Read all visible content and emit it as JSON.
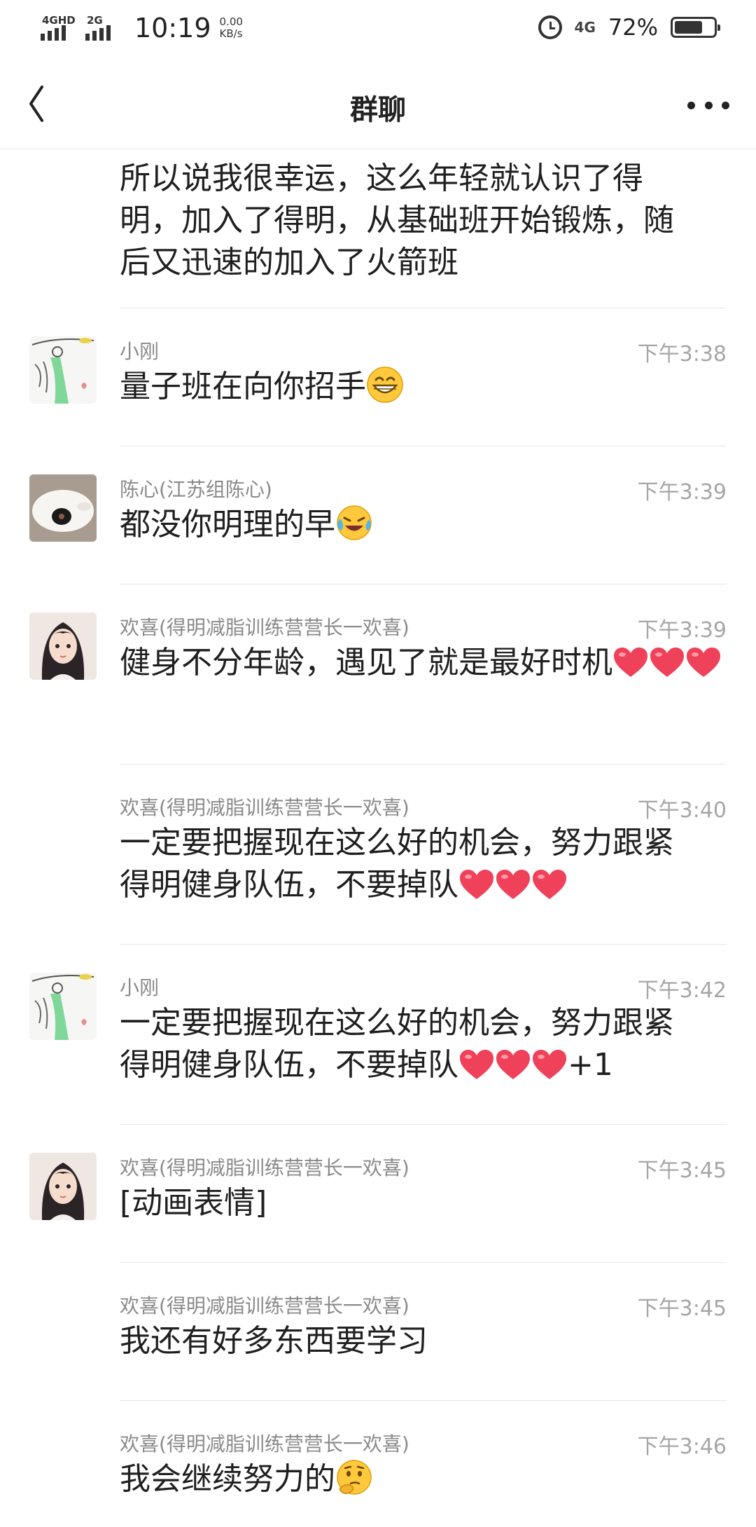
{
  "status_bar": {
    "net1": "4GHD",
    "net2": "2G",
    "time": "10:19",
    "speed_value": "0.00",
    "speed_unit": "KB/s",
    "net3": "4G",
    "battery_pct": "72%",
    "battery_level": 0.72
  },
  "header": {
    "title": "群聊"
  },
  "messages": [
    {
      "text_lines": [
        "所以说我很幸运，这么年轻就认识了得",
        "明，加入了得明，从基础班开始锻炼，随",
        "后又迅速的加入了火箭班"
      ]
    },
    {
      "name": "小刚",
      "time": "下午3:38",
      "text_lines": [
        "量子班在向你招手"
      ],
      "emoji": "grin-emoji"
    },
    {
      "name": "陈心(江苏组陈心)",
      "time": "下午3:39",
      "text_lines": [
        "都没你明理的早"
      ],
      "emoji": "laugh-cry-emoji"
    },
    {
      "name": "欢喜(得明减脂训练营营长一欢喜)",
      "time": "下午3:39",
      "text_lines": [
        "健身不分年龄，遇见了就是最好时机"
      ]
    },
    {
      "name": "欢喜(得明减脂训练营营长一欢喜)",
      "time": "下午3:40",
      "text_lines": [
        "一定要把握现在这么好的机会，努力跟紧",
        "得明健身队伍，不要掉队"
      ]
    },
    {
      "name": "小刚",
      "time": "下午3:42",
      "text_lines": [
        "一定要把握现在这么好的机会，努力跟紧",
        "得明健身队伍，不要掉队"
      ],
      "suffix": "+1"
    },
    {
      "name": "欢喜(得明减脂训练营营长一欢喜)",
      "time": "下午3:45",
      "text_lines": [
        "[动画表情]"
      ]
    },
    {
      "name": "欢喜(得明减脂训练营营长一欢喜)",
      "time": "下午3:45",
      "text_lines": [
        "我还有好多东西要学习"
      ]
    },
    {
      "name": "欢喜(得明减脂训练营营长一欢喜)",
      "time": "下午3:46",
      "text_lines": [
        "我会继续努力的"
      ],
      "emoji": "thinking-emoji"
    }
  ],
  "colors": {
    "heart": "#f0415a",
    "name": "#8a8a8a",
    "time": "#a6a6a6",
    "divider": "#e6e6e6"
  }
}
